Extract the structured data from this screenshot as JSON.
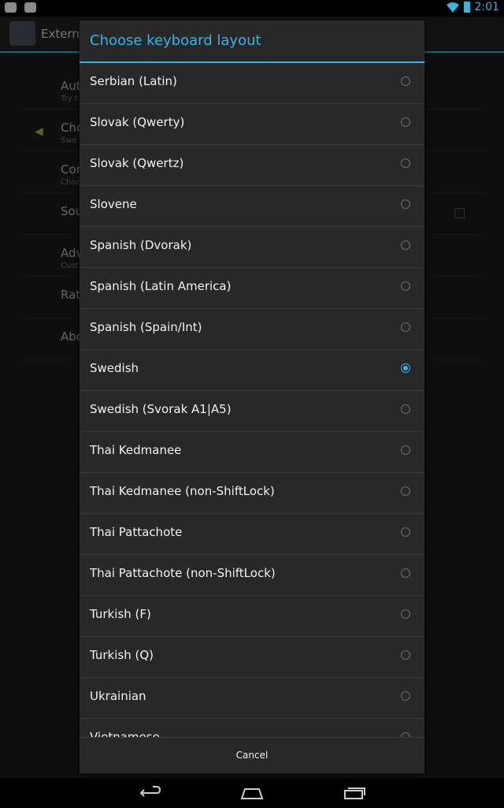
{
  "status_bar": {
    "time": "2:01"
  },
  "app": {
    "title": "Externa",
    "items": [
      {
        "title": "Auto",
        "subtitle": "Try t"
      },
      {
        "title": "Cho",
        "subtitle": "Swe"
      },
      {
        "title": "Con",
        "subtitle": "Choo"
      },
      {
        "title": "Sou",
        "subtitle": ""
      },
      {
        "title": "Adv",
        "subtitle": "Cust"
      },
      {
        "title": "Rate",
        "subtitle": ""
      },
      {
        "title": "Abo",
        "subtitle": ""
      }
    ]
  },
  "dialog": {
    "title": "Choose keyboard layout",
    "cancel_label": "Cancel",
    "selected_index": 7,
    "options": [
      "Serbian (Latin)",
      "Slovak (Qwerty)",
      "Slovak (Qwertz)",
      "Slovene",
      "Spanish (Dvorak)",
      "Spanish (Latin America)",
      "Spanish (Spain/Int)",
      "Swedish",
      "Swedish (Svorak A1|A5)",
      "Thai Kedmanee",
      "Thai Kedmanee (non-ShiftLock)",
      "Thai Pattachote",
      "Thai Pattachote (non-ShiftLock)",
      "Turkish (F)",
      "Turkish (Q)",
      "Ukrainian",
      "Vietnamese"
    ]
  },
  "icons": {
    "status_left": [
      "android-icon",
      "shopping-bag-icon"
    ],
    "status_right": [
      "wifi-icon",
      "battery-icon"
    ],
    "nav": [
      "back-icon",
      "home-icon",
      "recent-apps-icon"
    ]
  },
  "colors": {
    "accent": "#33b5e5",
    "dialog_bg": "#282828"
  }
}
